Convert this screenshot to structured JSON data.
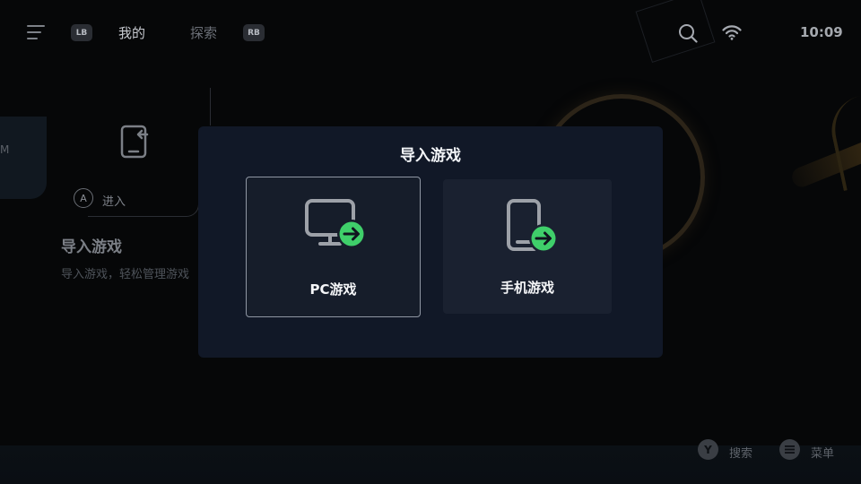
{
  "topbar": {
    "lb_badge": "LB",
    "tab_mine": "我的",
    "tab_explore": "探索",
    "rb_badge": "RB",
    "clock": "10:09",
    "icons": {
      "menu": "menu-icon",
      "search": "search-icon",
      "wifi": "wifi-icon"
    }
  },
  "background": {
    "card_letter": "M",
    "a_button": "A",
    "enter_label": "进入",
    "section_title": "导入游戏",
    "section_desc": "导入游戏，轻松管理游戏"
  },
  "modal": {
    "title": "导入游戏",
    "options": [
      {
        "label": "PC游戏",
        "icon": "monitor-arrow-icon",
        "selected": true
      },
      {
        "label": "手机游戏",
        "icon": "phone-arrow-icon",
        "selected": false
      }
    ],
    "accent_color": "#3fcf6a"
  },
  "bottombar": {
    "hint_y_button": "Y",
    "hint_y_label": "搜索",
    "hint_menu_label": "菜单"
  }
}
